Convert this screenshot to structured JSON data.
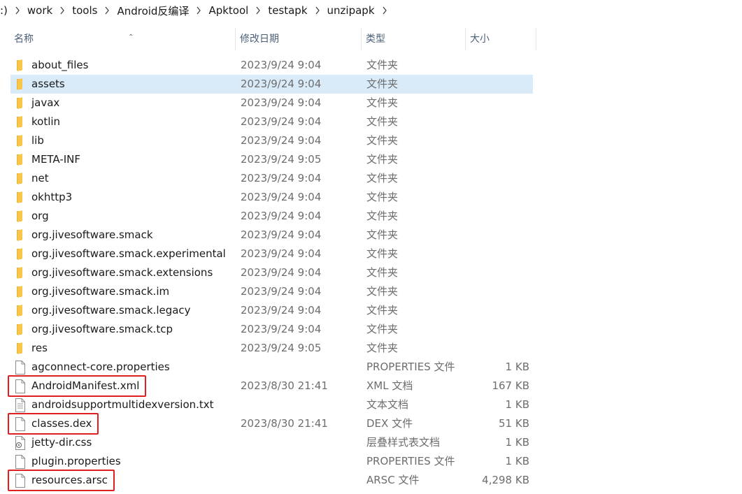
{
  "breadcrumb": [
    ":)",
    "work",
    "tools",
    "Android反编译",
    "Apktool",
    "testapk",
    "unzipapk"
  ],
  "columns": {
    "name": "名称",
    "date": "修改日期",
    "type": "类型",
    "size": "大小"
  },
  "files": [
    {
      "name": "about_files",
      "date": "2023/9/24 9:04",
      "type": "文件夹",
      "size": "",
      "icon": "folder-icon"
    },
    {
      "name": "assets",
      "date": "2023/9/24 9:04",
      "type": "文件夹",
      "size": "",
      "icon": "folder-icon",
      "selected": true
    },
    {
      "name": "javax",
      "date": "2023/9/24 9:04",
      "type": "文件夹",
      "size": "",
      "icon": "folder-icon"
    },
    {
      "name": "kotlin",
      "date": "2023/9/24 9:04",
      "type": "文件夹",
      "size": "",
      "icon": "folder-icon"
    },
    {
      "name": "lib",
      "date": "2023/9/24 9:04",
      "type": "文件夹",
      "size": "",
      "icon": "folder-icon"
    },
    {
      "name": "META-INF",
      "date": "2023/9/24 9:05",
      "type": "文件夹",
      "size": "",
      "icon": "folder-icon"
    },
    {
      "name": "net",
      "date": "2023/9/24 9:04",
      "type": "文件夹",
      "size": "",
      "icon": "folder-icon"
    },
    {
      "name": "okhttp3",
      "date": "2023/9/24 9:04",
      "type": "文件夹",
      "size": "",
      "icon": "folder-icon"
    },
    {
      "name": "org",
      "date": "2023/9/24 9:04",
      "type": "文件夹",
      "size": "",
      "icon": "folder-icon"
    },
    {
      "name": "org.jivesoftware.smack",
      "date": "2023/9/24 9:04",
      "type": "文件夹",
      "size": "",
      "icon": "folder-icon"
    },
    {
      "name": "org.jivesoftware.smack.experimental",
      "date": "2023/9/24 9:04",
      "type": "文件夹",
      "size": "",
      "icon": "folder-icon"
    },
    {
      "name": "org.jivesoftware.smack.extensions",
      "date": "2023/9/24 9:04",
      "type": "文件夹",
      "size": "",
      "icon": "folder-icon"
    },
    {
      "name": "org.jivesoftware.smack.im",
      "date": "2023/9/24 9:04",
      "type": "文件夹",
      "size": "",
      "icon": "folder-icon"
    },
    {
      "name": "org.jivesoftware.smack.legacy",
      "date": "2023/9/24 9:04",
      "type": "文件夹",
      "size": "",
      "icon": "folder-icon"
    },
    {
      "name": "org.jivesoftware.smack.tcp",
      "date": "2023/9/24 9:04",
      "type": "文件夹",
      "size": "",
      "icon": "folder-icon"
    },
    {
      "name": "res",
      "date": "2023/9/24 9:05",
      "type": "文件夹",
      "size": "",
      "icon": "folder-icon"
    },
    {
      "name": "agconnect-core.properties",
      "date": "",
      "type": "PROPERTIES 文件",
      "size": "1 KB",
      "icon": "file-icon"
    },
    {
      "name": "AndroidManifest.xml",
      "date": "2023/8/30 21:41",
      "type": "XML 文档",
      "size": "167 KB",
      "icon": "file-icon",
      "highlighted": true
    },
    {
      "name": "androidsupportmultidexversion.txt",
      "date": "",
      "type": "文本文档",
      "size": "1 KB",
      "icon": "text-file-icon"
    },
    {
      "name": "classes.dex",
      "date": "2023/8/30 21:41",
      "type": "DEX 文件",
      "size": "51 KB",
      "icon": "file-icon",
      "highlighted": true
    },
    {
      "name": "jetty-dir.css",
      "date": "",
      "type": "层叠样式表文档",
      "size": "1 KB",
      "icon": "css-file-icon"
    },
    {
      "name": "plugin.properties",
      "date": "",
      "type": "PROPERTIES 文件",
      "size": "1 KB",
      "icon": "file-icon"
    },
    {
      "name": "resources.arsc",
      "date": "",
      "type": "ARSC 文件",
      "size": "4,298 KB",
      "icon": "file-icon",
      "highlighted": true
    }
  ],
  "colors": {
    "highlight": "#e02020",
    "selection": "#d9ebf9",
    "folder": "#f8c74a"
  }
}
